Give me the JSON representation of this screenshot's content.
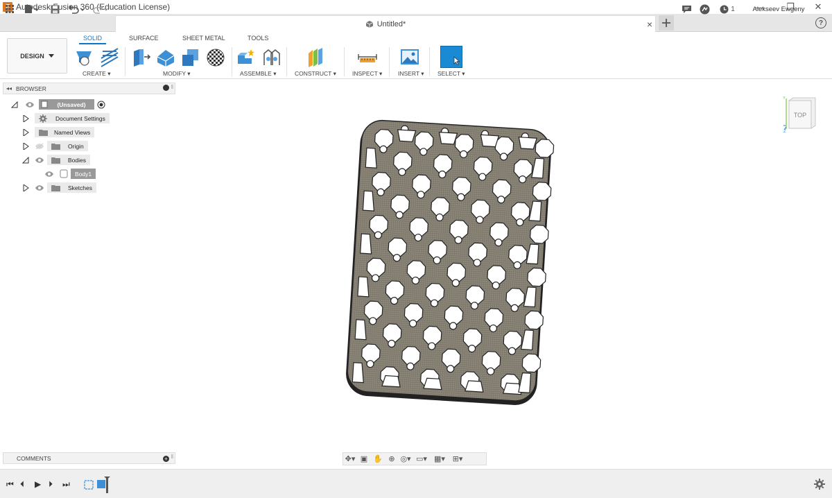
{
  "window": {
    "title": "Autodesk Fusion 360 (Education License)",
    "app_icon_letter": "F",
    "minimize_glyph": "—",
    "restore_glyph": "❐",
    "close_glyph": "✕"
  },
  "quick_access": {
    "document_title": "Untitled*",
    "user_name": "Alekseev Ewgeny",
    "job_count": "1",
    "close_tab_glyph": "×",
    "help_glyph": "?"
  },
  "ribbon": {
    "workspace_label": "DESIGN",
    "tabs": [
      {
        "label": "SOLID",
        "active": true
      },
      {
        "label": "SURFACE",
        "active": false
      },
      {
        "label": "SHEET METAL",
        "active": false
      },
      {
        "label": "TOOLS",
        "active": false
      }
    ],
    "groups": {
      "create": "CREATE",
      "modify": "MODIFY",
      "assemble": "ASSEMBLE",
      "construct": "CONSTRUCT",
      "inspect": "INSPECT",
      "insert": "INSERT",
      "select": "SELECT"
    },
    "accent_color": "#0a78c8"
  },
  "browser": {
    "title": "BROWSER",
    "root": "(Unsaved)",
    "items": [
      {
        "label": "Document Settings"
      },
      {
        "label": "Named Views"
      },
      {
        "label": "Origin"
      },
      {
        "label": "Bodies"
      },
      {
        "label": "Body1"
      },
      {
        "label": "Sketches"
      }
    ]
  },
  "comments": {
    "title": "COMMENTS"
  },
  "viewcube": {
    "face": "TOP",
    "axis_z": "Z",
    "axis_y": "Y"
  }
}
